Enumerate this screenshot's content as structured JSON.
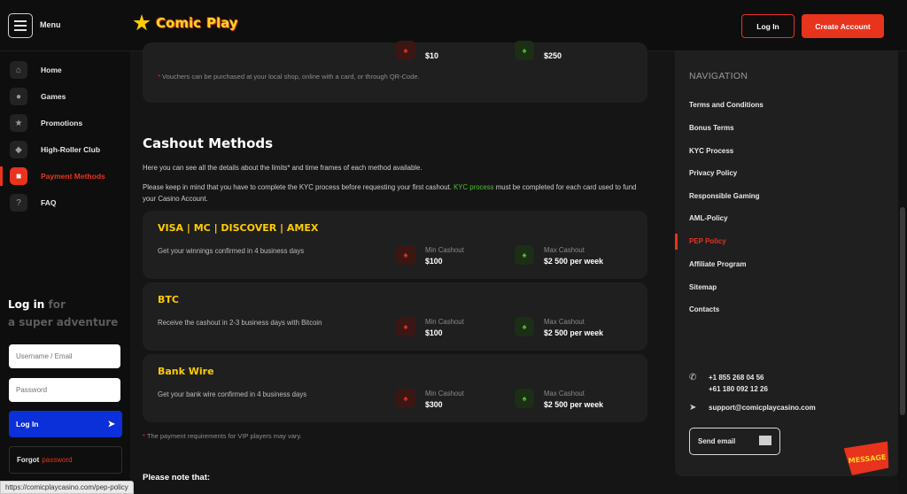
{
  "header": {
    "menu_label": "Menu",
    "logo_word1": "Comic",
    "logo_word2": "Play",
    "login_label": "Log In",
    "create_label": "Create Account"
  },
  "sidebar": {
    "items": [
      {
        "label": "Home",
        "icon": "home-icon"
      },
      {
        "label": "Games",
        "icon": "cherries-icon"
      },
      {
        "label": "Promotions",
        "icon": "star-icon"
      },
      {
        "label": "High-Roller Club",
        "icon": "diamond-icon"
      },
      {
        "label": "Payment Methods",
        "icon": "wallet-icon",
        "active": true
      },
      {
        "label": "FAQ",
        "icon": "question-icon"
      }
    ],
    "login_title": "Log in",
    "login_for": "for",
    "login_tagline": "a super adventure",
    "username_placeholder": "Username / Email",
    "password_placeholder": "Password",
    "login_button": "Log In",
    "forgot_label": "Forgot",
    "forgot_password": "password"
  },
  "voucher": {
    "min_value": "$10",
    "max_value": "$250",
    "note": "Vouchers can be purchased at your local shop, online with a card, or through QR-Code."
  },
  "cashout": {
    "title": "Cashout Methods",
    "intro": "Here you can see all the details about the limits* and time frames of each method available.",
    "kyc_before": "Please keep in mind that you have to complete the KYC process before requesting your first cashout.",
    "kyc_link": "KYC process",
    "kyc_after": "must be completed for each card used to fund your Casino Account.",
    "min_label": "Min Cashout",
    "max_label": "Max Cashout",
    "methods": [
      {
        "name": "VISA | MC | DISCOVER | AMEX",
        "desc": "Get your winnings confirmed in 4 business days",
        "min": "$100",
        "max": "$2 500 per week"
      },
      {
        "name": "BTC",
        "desc": "Receive the cashout in 2-3 business days with Bitcoin",
        "min": "$100",
        "max": "$2 500 per week"
      },
      {
        "name": "Bank Wire",
        "desc": "Get your bank wire confirmed in 4 business days",
        "min": "$300",
        "max": "$2 500 per week"
      }
    ],
    "footnote": "The payment requirements for VIP players may vary.",
    "please_note": "Please note that:"
  },
  "right_panel": {
    "heading": "NAVIGATION",
    "links": [
      "Terms and Conditions",
      "Bonus Terms",
      "KYC Process",
      "Privacy Policy",
      "Responsible Gaming",
      "AML-Policy",
      "PEP Policy",
      "Affiliate Program",
      "Sitemap",
      "Contacts"
    ],
    "active_link": "PEP Policy",
    "phone1": "+1 855 268 04 56",
    "phone2": "+61 180 092 12 26",
    "email": "support@comicplaycasino.com",
    "send_email": "Send email"
  },
  "message_badge": "MESSAGE",
  "status_url": "https://comicplaycasino.com/pep-policy",
  "colors": {
    "accent": "#e8331d",
    "gold": "#ffcc00",
    "green": "#53c02c",
    "blue": "#0b2fd8"
  }
}
